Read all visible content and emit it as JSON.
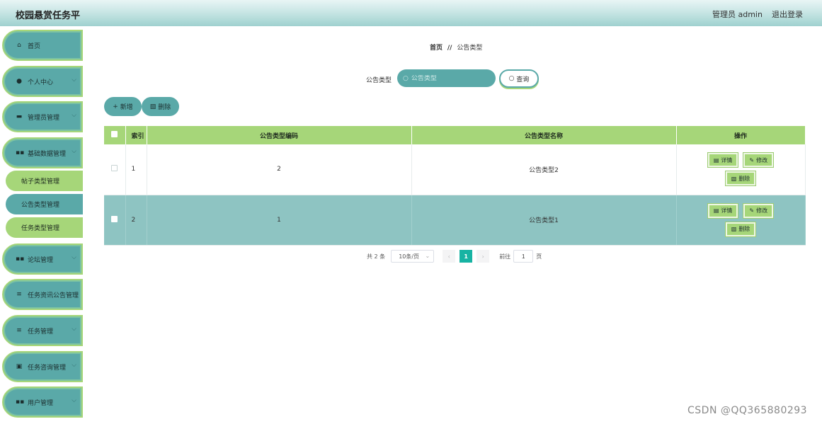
{
  "app": {
    "title": "校园悬赏任务平",
    "user_label": "管理员 admin",
    "logout_label": "退出登录"
  },
  "sidebar": {
    "items": [
      {
        "label": "首页",
        "icon": "home-icon",
        "glyph": "⌂",
        "chevron": ""
      },
      {
        "label": "个人中心",
        "icon": "user-icon",
        "glyph": "●",
        "chevron": "⌵"
      },
      {
        "label": "管理员管理",
        "icon": "chat-icon",
        "glyph": "▬",
        "chevron": "⌵"
      },
      {
        "label": "基础数据管理",
        "icon": "grid-icon",
        "glyph": "▪▪",
        "chevron": "⌵"
      },
      {
        "label": "论坛管理",
        "icon": "grid-icon",
        "glyph": "▪▪",
        "chevron": "⌵"
      },
      {
        "label": "任务资讯公告管理",
        "icon": "list-icon",
        "glyph": "≡",
        "chevron": "⌵"
      },
      {
        "label": "任务管理",
        "icon": "list-icon",
        "glyph": "≡",
        "chevron": "⌵"
      },
      {
        "label": "任务咨询管理",
        "icon": "clipboard-icon",
        "glyph": "▣",
        "chevron": "⌵"
      },
      {
        "label": "用户管理",
        "icon": "grid-icon",
        "glyph": "▪▪",
        "chevron": "⌵"
      }
    ],
    "sub_items": [
      "帖子类型管理",
      "公告类型管理",
      "任务类型管理"
    ]
  },
  "breadcrumb": {
    "home": "首页",
    "sep": "//",
    "current": "公告类型"
  },
  "search": {
    "label": "公告类型",
    "placeholder": "公告类型",
    "value": "",
    "button": "查询"
  },
  "actions": {
    "add": "新增",
    "delete": "删除"
  },
  "table": {
    "headers": [
      "索引",
      "公告类型编码",
      "公告类型名称",
      "操作"
    ],
    "rows": [
      {
        "index": "1",
        "code": "2",
        "name": "公告类型2"
      },
      {
        "index": "2",
        "code": "1",
        "name": "公告类型1"
      }
    ],
    "op_labels": {
      "detail": "详情",
      "edit": "修改",
      "delete": "删除"
    }
  },
  "pagination": {
    "total": "共 2 条",
    "page_size": "10条/页",
    "prev": "‹",
    "current_page": "1",
    "next": "›",
    "goto_label": "前往",
    "goto_value": "1",
    "page_suffix": "页"
  },
  "watermark": "CSDN @QQ365880293",
  "colors": {
    "teal": "#5aa9a8",
    "green": "#a6d679",
    "row_highlight": "#8ec4c2",
    "page_active": "#17b3a3"
  }
}
